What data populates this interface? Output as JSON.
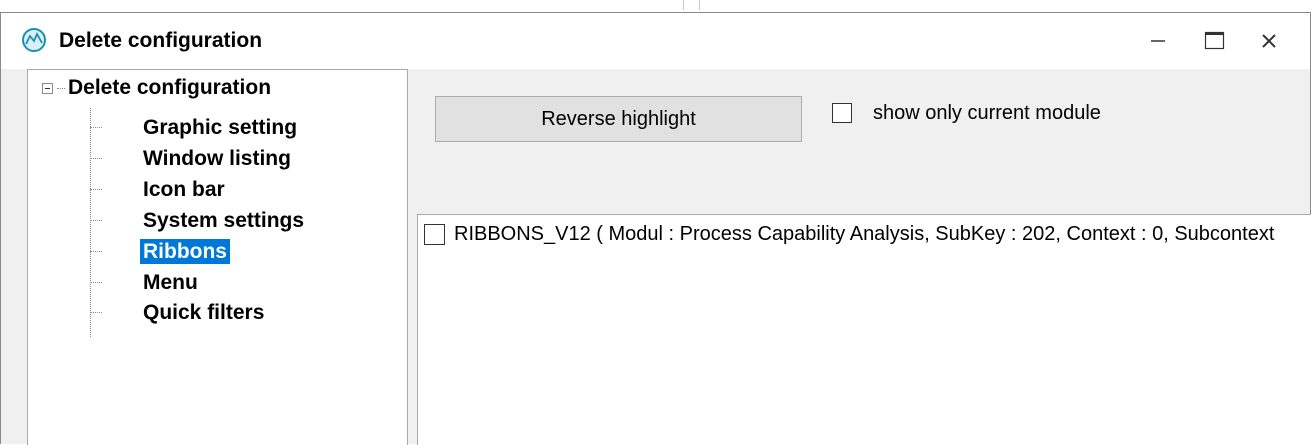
{
  "window": {
    "title": "Delete configuration",
    "icon": "app-logo-icon",
    "controls": [
      "minimize-icon",
      "maximize-icon",
      "close-icon"
    ]
  },
  "tree": {
    "root_label": "Delete configuration",
    "items": [
      {
        "label": "Graphic setting"
      },
      {
        "label": "Window listing"
      },
      {
        "label": "Icon bar"
      },
      {
        "label": "System settings"
      },
      {
        "label": "Ribbons",
        "selected": true
      },
      {
        "label": "Menu"
      },
      {
        "label": "Quick filters"
      }
    ]
  },
  "toolbar": {
    "reverse_highlight_label": "Reverse highlight",
    "show_only_current_module_label": "show only current module",
    "show_only_current_module_checked": false
  },
  "list": {
    "rows": [
      {
        "text": "RIBBONS_V12 ( Modul : Process Capability Analysis, SubKey : 202, Context : 0, Subcontext",
        "checked": false
      }
    ]
  },
  "colors": {
    "selection": "#0078d7",
    "window_bg": "#f0f0f0",
    "button_bg": "#e1e1e1"
  }
}
